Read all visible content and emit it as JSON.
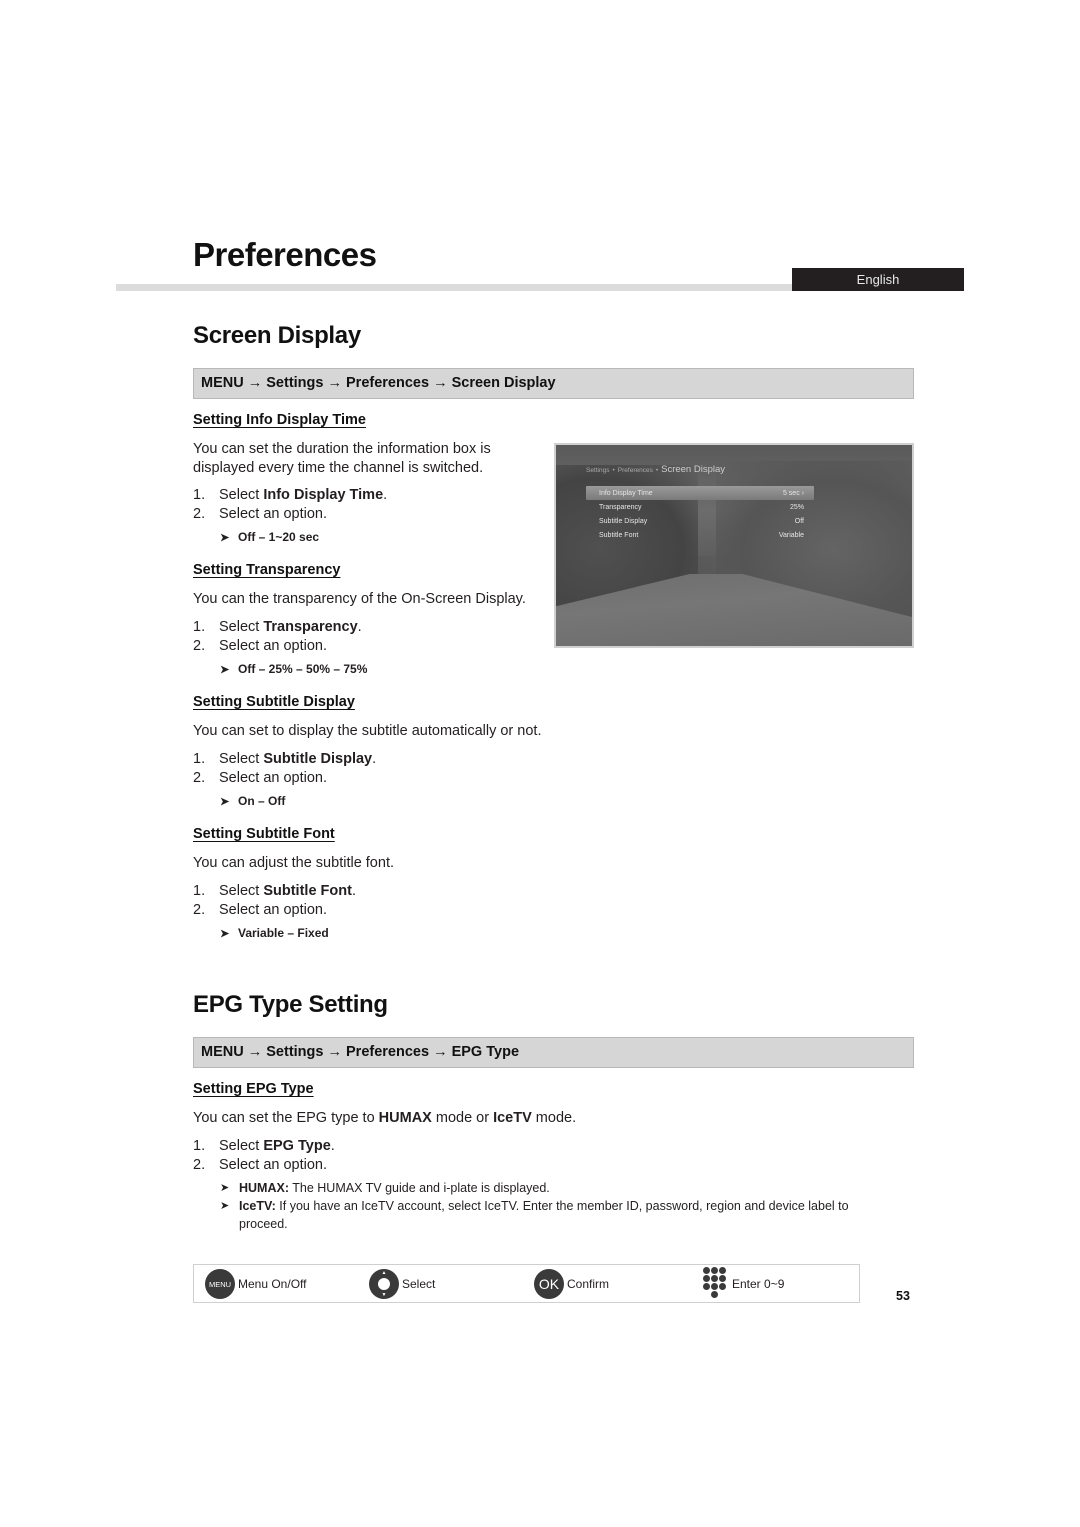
{
  "header": {
    "title": "Preferences",
    "language": "English"
  },
  "screen_display": {
    "title": "Screen Display",
    "menu_path": "MENU → Settings → Preferences → Screen Display",
    "sections": [
      {
        "heading": "Setting Info Display Time",
        "description_lines": [
          "You can set the duration the information box is",
          "displayed every time the channel is switched."
        ],
        "steps": [
          {
            "num": "1.",
            "prefix": "Select ",
            "bold": "Info Display Time",
            "suffix": "."
          },
          {
            "num": "2.",
            "prefix": "Select an option.",
            "bold": "",
            "suffix": ""
          }
        ],
        "options": "Off – 1~20 sec"
      },
      {
        "heading": "Setting Transparency",
        "description_lines": [
          "You can the transparency of the On-Screen Display."
        ],
        "steps": [
          {
            "num": "1.",
            "prefix": "Select ",
            "bold": "Transparency",
            "suffix": "."
          },
          {
            "num": "2.",
            "prefix": "Select an option.",
            "bold": "",
            "suffix": ""
          }
        ],
        "options": "Off – 25% – 50% – 75%"
      },
      {
        "heading": "Setting Subtitle Display",
        "description_lines": [
          "You can set to display the subtitle automatically or not."
        ],
        "steps": [
          {
            "num": "1.",
            "prefix": "Select ",
            "bold": "Subtitle Display",
            "suffix": "."
          },
          {
            "num": "2.",
            "prefix": "Select an option.",
            "bold": "",
            "suffix": ""
          }
        ],
        "options": "On – Off"
      },
      {
        "heading": "Setting Subtitle Font",
        "description_lines": [
          "You can adjust the subtitle font."
        ],
        "steps": [
          {
            "num": "1.",
            "prefix": "Select ",
            "bold": "Subtitle Font",
            "suffix": "."
          },
          {
            "num": "2.",
            "prefix": "Select an option.",
            "bold": "",
            "suffix": ""
          }
        ],
        "options": "Variable – Fixed"
      }
    ],
    "tv_screen": {
      "breadcrumb": [
        "Settings",
        "Preferences"
      ],
      "breadcrumb_current": "Screen Display",
      "rows": [
        {
          "label": "Info Display Time",
          "value": "5 sec",
          "selected": true
        },
        {
          "label": "Transparency",
          "value": "25%",
          "selected": false
        },
        {
          "label": "Subtitle Display",
          "value": "Off",
          "selected": false
        },
        {
          "label": "Subtitle Font",
          "value": "Variable",
          "selected": false
        }
      ]
    }
  },
  "epg": {
    "title": "EPG Type Setting",
    "menu_path": "MENU → Settings → Preferences → EPG Type",
    "heading": "Setting EPG Type",
    "description": {
      "p1": "You can set the EPG type to ",
      "b1": "HUMAX",
      "p2": " mode or ",
      "b2": "IceTV",
      "p3": " mode."
    },
    "steps": [
      {
        "num": "1.",
        "prefix": "Select ",
        "bold": "EPG Type",
        "suffix": "."
      },
      {
        "num": "2.",
        "prefix": "Select an option.",
        "bold": "",
        "suffix": ""
      }
    ],
    "bullets": [
      {
        "bold": "HUMAX:",
        "text": " The HUMAX TV guide and i-plate is displayed."
      },
      {
        "bold": "IceTV:",
        "text": " If you have an IceTV account, select IceTV. Enter the member ID, password, region and device label to proceed."
      }
    ]
  },
  "legend": {
    "items": [
      {
        "icon": "menu-button-icon",
        "icon_text": "MENU",
        "label": "Menu On/Off"
      },
      {
        "icon": "navigation-button-icon",
        "icon_text": "",
        "label": "Select"
      },
      {
        "icon": "ok-button-icon",
        "icon_text": "OK",
        "label": "Confirm"
      },
      {
        "icon": "numeric-keypad-icon",
        "icon_text": "",
        "label": "Enter 0~9"
      }
    ]
  },
  "page_number": "53",
  "glyphs": {
    "chevron": "➤"
  }
}
